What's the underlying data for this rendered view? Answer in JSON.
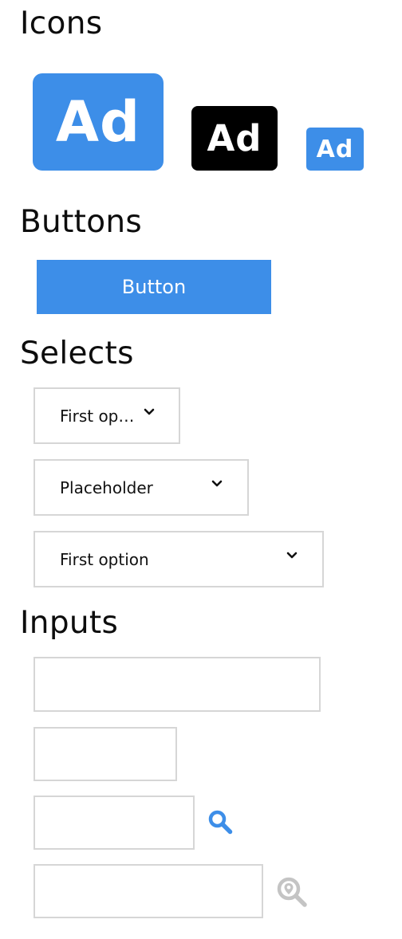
{
  "sections": {
    "icons": {
      "title": "Icons"
    },
    "buttons": {
      "title": "Buttons"
    },
    "selects": {
      "title": "Selects"
    },
    "inputs": {
      "title": "Inputs"
    }
  },
  "icons": [
    {
      "label": "Ad",
      "color": "#3d8ee8",
      "size": "large"
    },
    {
      "label": "Ad",
      "color": "#000000",
      "size": "medium"
    },
    {
      "label": "Ad",
      "color": "#3d8ee8",
      "size": "small"
    }
  ],
  "button": {
    "label": "Button",
    "color": "#3d8ee8"
  },
  "selects": [
    {
      "value": "First op…"
    },
    {
      "value": "Placeholder"
    },
    {
      "value": "First option"
    }
  ],
  "inputs": [
    {
      "value": "",
      "placeholder": ""
    },
    {
      "value": "",
      "placeholder": ""
    },
    {
      "value": "",
      "placeholder": "",
      "icon": "search-icon"
    },
    {
      "value": "",
      "placeholder": "",
      "icon": "location-search-icon"
    }
  ],
  "colors": {
    "accent": "#3d8ee8",
    "border": "#d6d6d6",
    "muted_icon": "#c4c4c4"
  }
}
